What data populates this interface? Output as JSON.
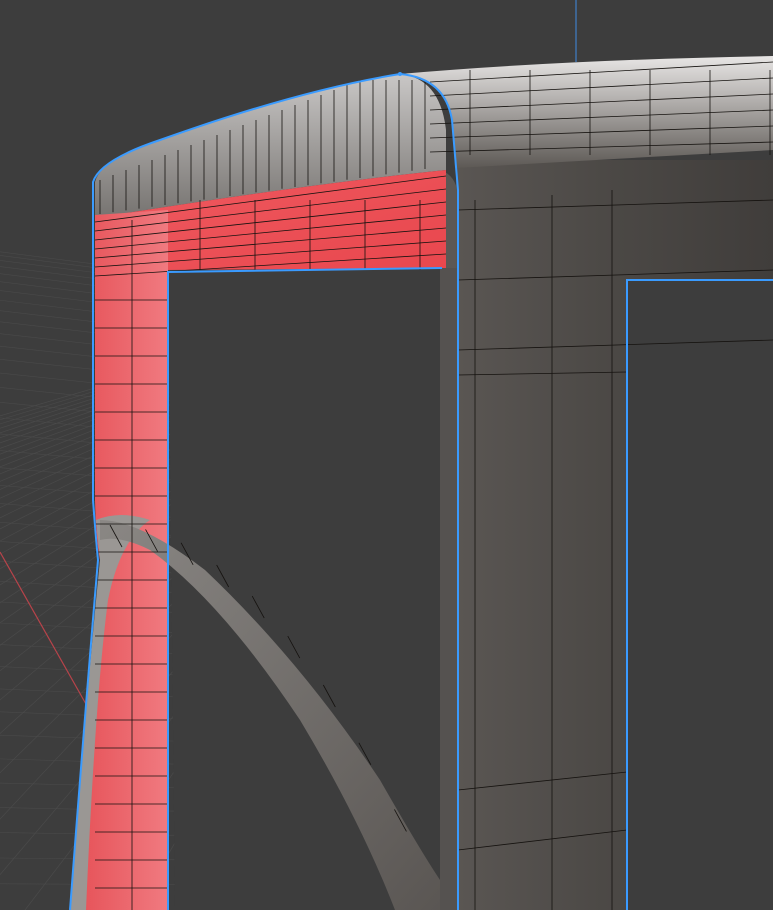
{
  "viewport": {
    "background": "#3d3d3d",
    "grid_color": "#4a4a4a",
    "x_axis_color": "#b8434a",
    "z_axis_color": "#3f7fc8"
  },
  "mesh": {
    "face_color": "#4e4a47",
    "face_light_color": "#d9d7d6",
    "edge_color": "#15120f",
    "selected_face_color": "#e8525a",
    "outline_color": "#3a9bff"
  },
  "icons": {
    "grid": "grid-floor-icon",
    "mesh": "mesh-object-icon"
  }
}
